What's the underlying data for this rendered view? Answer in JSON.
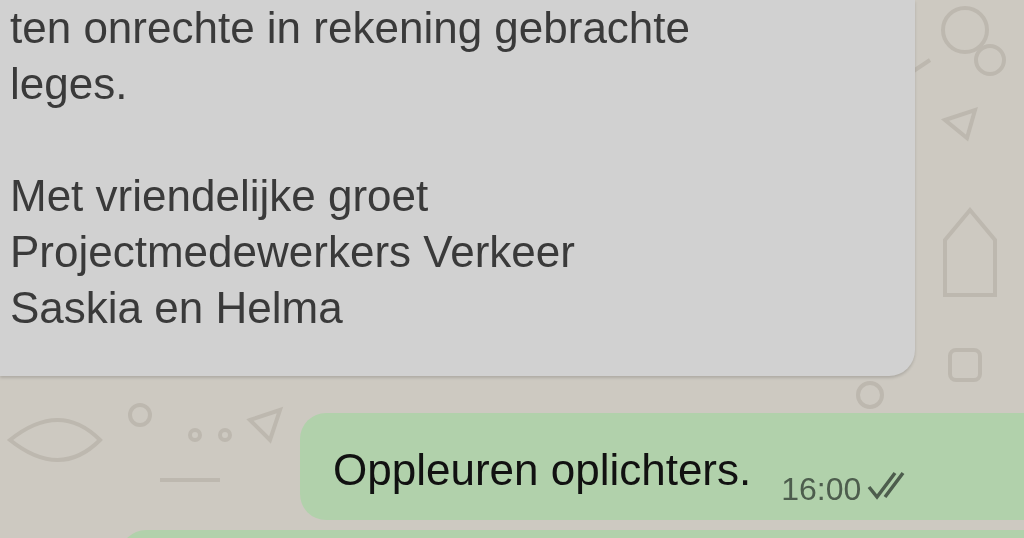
{
  "messages": [
    {
      "kind": "incoming",
      "paragraphs": [
        [
          "ten onrechte in rekening gebrachte",
          "leges."
        ],
        [
          "Met vriendelijke groet",
          "Projectmedewerkers Verkeer",
          "Saskia en Helma"
        ]
      ]
    },
    {
      "kind": "outgoing",
      "text": "Oppleuren oplichters.",
      "time": "16:00",
      "read": false
    },
    {
      "kind": "outgoing-partial"
    }
  ]
}
